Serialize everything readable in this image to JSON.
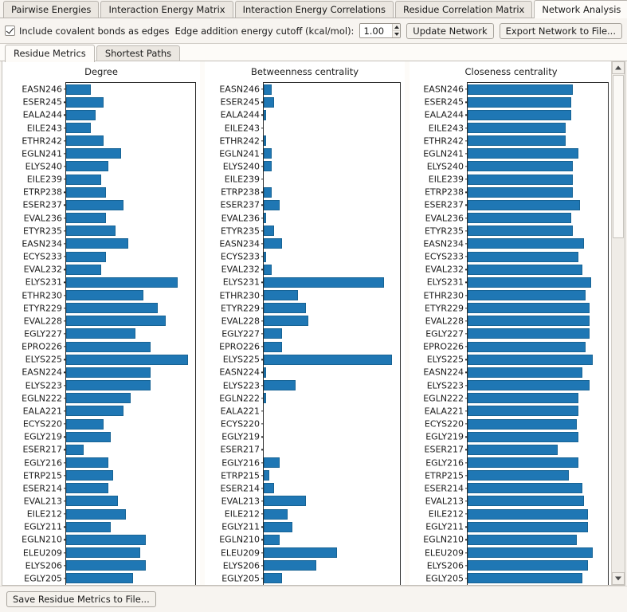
{
  "window": {
    "tabs": [
      {
        "label": "Pairwise Energies",
        "active": false
      },
      {
        "label": "Interaction Energy Matrix",
        "active": false
      },
      {
        "label": "Interaction Energy Correlations",
        "active": false
      },
      {
        "label": "Residue Correlation Matrix",
        "active": false
      },
      {
        "label": "Network Analysis",
        "active": true
      }
    ]
  },
  "options": {
    "covalent_checkbox_label": "Include covalent bonds as edges",
    "covalent_checkbox_checked": true,
    "cutoff_label": "Edge addition energy cutoff (kcal/mol):",
    "cutoff_value": "1.00",
    "update_button": "Update Network",
    "export_button": "Export Network to File..."
  },
  "subtabs": [
    {
      "label": "Residue Metrics",
      "active": true
    },
    {
      "label": "Shortest Paths",
      "active": false
    }
  ],
  "bottom": {
    "save_button": "Save Residue Metrics to File..."
  },
  "colors": {
    "bar_fill": "#1f77b4",
    "bar_edge": "#176394",
    "panel_bg": "#ffffff",
    "window_bg": "#f7f4f0"
  },
  "chart_data": [
    {
      "type": "bar",
      "orientation": "horizontal",
      "title": "Degree",
      "xlabel": "",
      "ylabel": "",
      "grid": false,
      "legend": null,
      "categories": [
        "EASN246",
        "ESER245",
        "EALA244",
        "EILE243",
        "ETHR242",
        "EGLN241",
        "ELYS240",
        "EILE239",
        "ETRP238",
        "ESER237",
        "EVAL236",
        "ETYR235",
        "EASN234",
        "ECYS233",
        "EVAL232",
        "ELYS231",
        "ETHR230",
        "ETYR229",
        "EVAL228",
        "EGLY227",
        "EPRO226",
        "ELYS225",
        "EASN224",
        "ELYS223",
        "EGLN222",
        "EALA221",
        "ECYS220",
        "EGLY219",
        "ESER217",
        "EGLY216",
        "ETRP215",
        "ESER214",
        "EVAL213",
        "EILE212",
        "EGLY211",
        "EGLN210",
        "ELEU209",
        "ELYS206",
        "EGLY205"
      ],
      "values": [
        10,
        15,
        12,
        10,
        15,
        22,
        17,
        14,
        16,
        23,
        16,
        20,
        25,
        16,
        14,
        45,
        31,
        37,
        40,
        28,
        34,
        49,
        34,
        34,
        26,
        23,
        15,
        18,
        7,
        17,
        19,
        17,
        21,
        24,
        18,
        32,
        30,
        32,
        27
      ],
      "xlim": [
        0,
        52
      ]
    },
    {
      "type": "bar",
      "orientation": "horizontal",
      "title": "Betweenness centrality",
      "xlabel": "",
      "ylabel": "",
      "grid": false,
      "legend": null,
      "categories": [
        "EASN246",
        "ESER245",
        "EALA244",
        "EILE243",
        "ETHR242",
        "EGLN241",
        "ELYS240",
        "EILE239",
        "ETRP238",
        "ESER237",
        "EVAL236",
        "ETYR235",
        "EASN234",
        "ECYS233",
        "EVAL232",
        "ELYS231",
        "ETHR230",
        "ETYR229",
        "EVAL228",
        "EGLY227",
        "EPRO226",
        "ELYS225",
        "EASN224",
        "ELYS223",
        "EGLN222",
        "EALA221",
        "ECYS220",
        "EGLY219",
        "ESER217",
        "EGLY216",
        "ETRP215",
        "ESER214",
        "EVAL213",
        "EILE212",
        "EGLY211",
        "EGLN210",
        "ELEU209",
        "ELYS206",
        "EGLY205"
      ],
      "values": [
        3,
        4,
        1,
        0,
        1,
        3,
        3,
        0,
        3,
        6,
        1,
        4,
        7,
        1,
        3,
        46,
        13,
        16,
        17,
        7,
        7,
        49,
        1,
        12,
        1,
        0,
        0,
        0,
        0,
        6,
        2,
        4,
        16,
        9,
        11,
        6,
        28,
        20,
        7
      ],
      "xlim": [
        0,
        52
      ]
    },
    {
      "type": "bar",
      "orientation": "horizontal",
      "title": "Closeness centrality",
      "xlabel": "",
      "ylabel": "",
      "grid": false,
      "legend": null,
      "categories": [
        "EASN246",
        "ESER245",
        "EALA244",
        "EILE243",
        "ETHR242",
        "EGLN241",
        "ELYS240",
        "EILE239",
        "ETRP238",
        "ESER237",
        "EVAL236",
        "ETYR235",
        "EASN234",
        "ECYS233",
        "EVAL232",
        "ELYS231",
        "ETHR230",
        "ETYR229",
        "EVAL228",
        "EGLY227",
        "EPRO226",
        "ELYS225",
        "EASN224",
        "ELYS223",
        "EGLN222",
        "EALA221",
        "ECYS220",
        "EGLY219",
        "ESER217",
        "EGLY216",
        "ETRP215",
        "ESER214",
        "EVAL213",
        "EILE212",
        "EGLY211",
        "EGLN210",
        "ELEU209",
        "ELYS206",
        "EGLY205"
      ],
      "values": [
        57,
        56,
        56,
        53,
        53,
        60,
        57,
        57,
        57,
        61,
        56,
        57,
        63,
        60,
        62,
        67,
        64,
        66,
        66,
        66,
        64,
        68,
        62,
        66,
        60,
        60,
        59,
        60,
        49,
        60,
        55,
        62,
        63,
        65,
        65,
        59,
        68,
        65,
        62
      ],
      "xlim": [
        0,
        76
      ]
    }
  ]
}
